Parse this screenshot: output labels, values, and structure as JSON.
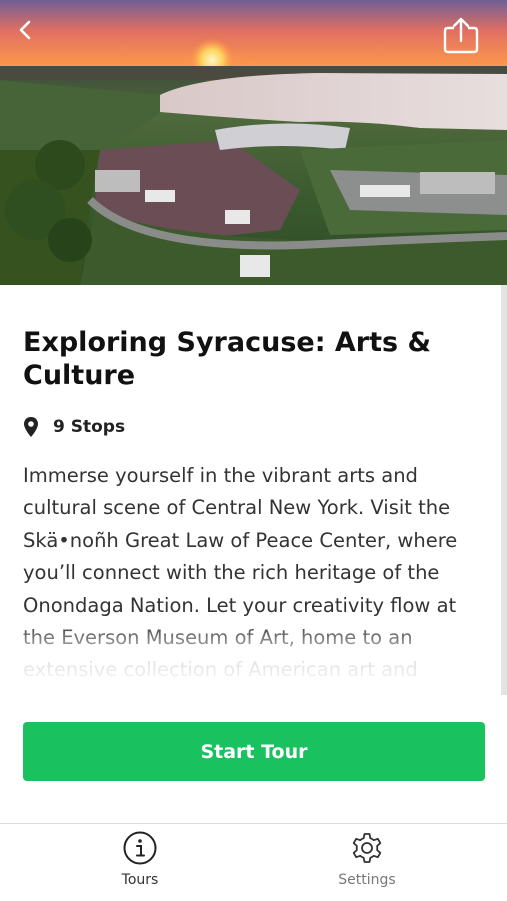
{
  "header": {
    "back_icon": "chevron-left-icon",
    "share_icon": "share-icon",
    "hero_image": "aerial view of amphitheater by lake at sunset"
  },
  "tour": {
    "title": "Exploring Syracuse: Arts & Culture",
    "stops_icon": "map-pin-icon",
    "stops_label": "9 Stops",
    "description": "Immerse yourself in the vibrant arts and cultural scene of Central New York. Visit the Skä•noñh Great Law of Peace Center, where you’ll connect with the rich heritage of the Onondaga Nation. Let your creativity flow at the Everson Museum of Art, home to an extensive collection of American art and ceramics. Dive"
  },
  "actions": {
    "start_label": "Start Tour",
    "start_color": "#19c25f"
  },
  "tabbar": {
    "tabs": [
      {
        "label": "Tours",
        "icon": "info-icon",
        "active": true
      },
      {
        "label": "Settings",
        "icon": "gear-icon",
        "active": false
      }
    ]
  }
}
